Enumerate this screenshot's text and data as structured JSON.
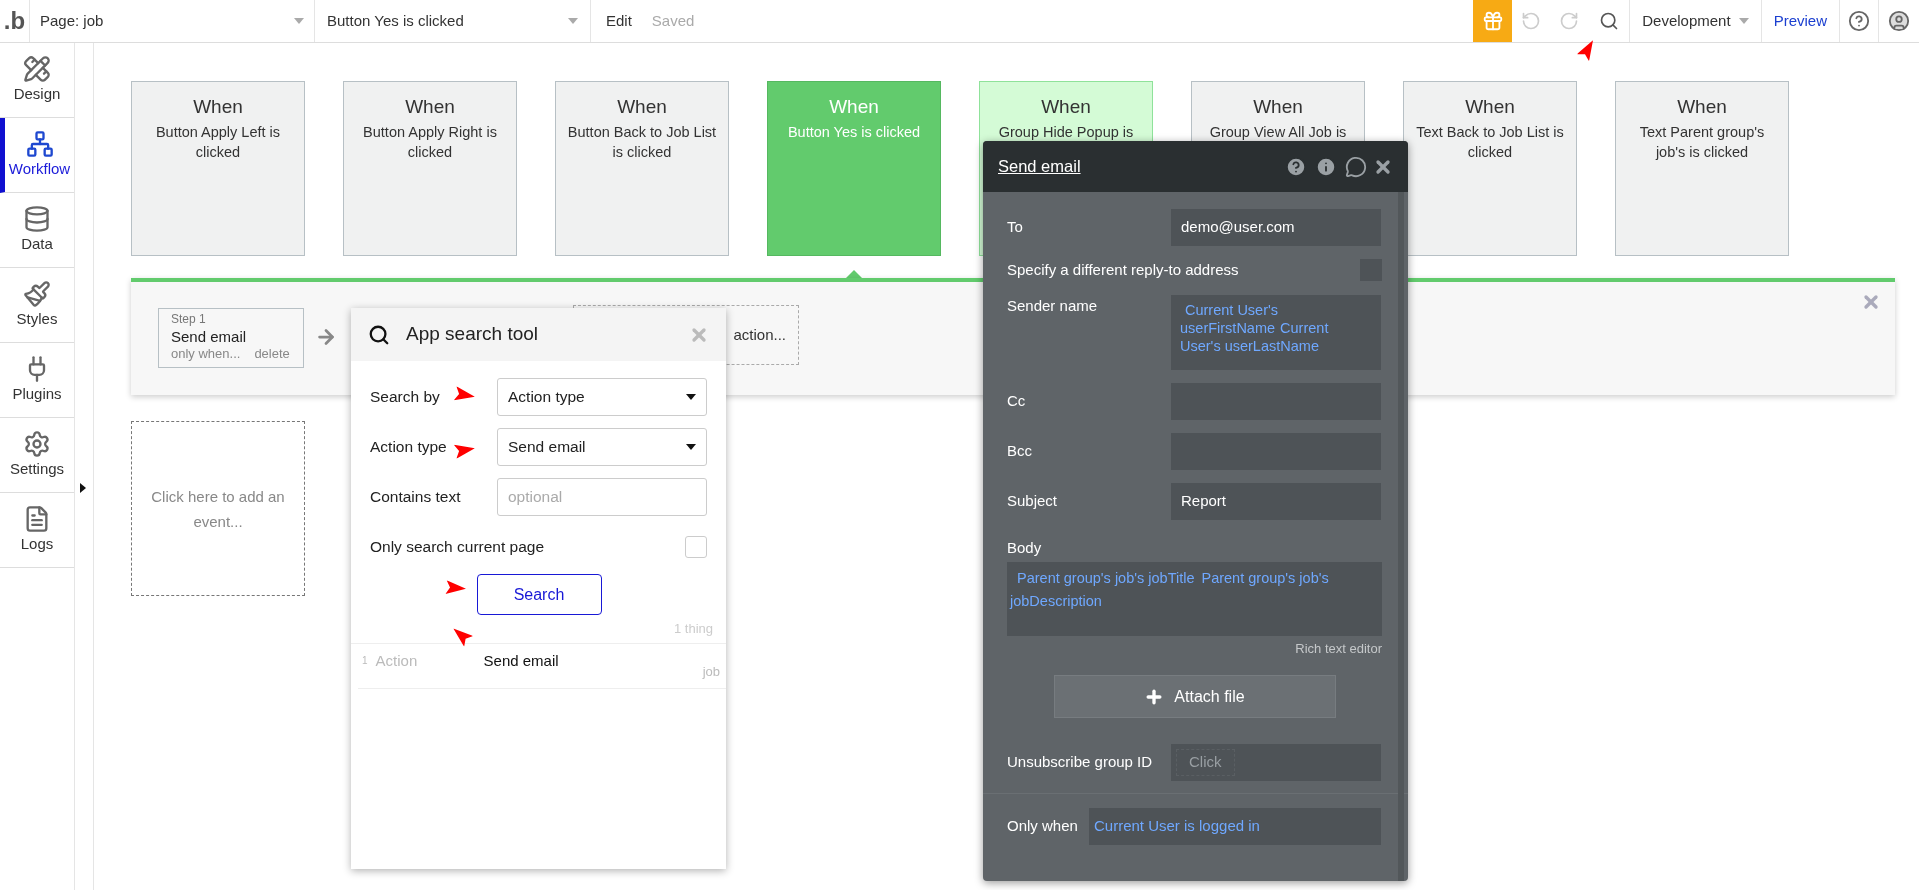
{
  "top_bar": {
    "logo": ".b",
    "page_dropdown": "Page: job",
    "event_dropdown": "Button Yes is clicked",
    "edit": "Edit",
    "save_status": "Saved",
    "environment": "Development",
    "preview": "Preview"
  },
  "sidebar": {
    "items": [
      {
        "label": "Design",
        "kind": "design",
        "selected": false
      },
      {
        "label": "Workflow",
        "kind": "workflow",
        "selected": true
      },
      {
        "label": "Data",
        "kind": "data",
        "selected": false
      },
      {
        "label": "Styles",
        "kind": "styles",
        "selected": false
      },
      {
        "label": "Plugins",
        "kind": "plugins",
        "selected": false
      },
      {
        "label": "Settings",
        "kind": "settings",
        "selected": false
      },
      {
        "label": "Logs",
        "kind": "logs",
        "selected": false
      }
    ]
  },
  "events": [
    {
      "title": "When",
      "description": "Button Apply Left is clicked",
      "selected": false,
      "highlighted": false
    },
    {
      "title": "When",
      "description": "Button Apply Right is clicked",
      "selected": false,
      "highlighted": false
    },
    {
      "title": "When",
      "description": "Button Back to Job List is clicked",
      "selected": false,
      "highlighted": false
    },
    {
      "title": "When",
      "description": "Button Yes is clicked",
      "selected": true,
      "highlighted": false
    },
    {
      "title": "When",
      "description": "Group Hide Popup is",
      "selected": false,
      "highlighted": true
    },
    {
      "title": "When",
      "description": "Group View All Job is",
      "selected": false,
      "highlighted": false
    },
    {
      "title": "When",
      "description": "Text Back to Job List is clicked",
      "selected": false,
      "highlighted": false
    },
    {
      "title": "When",
      "description": "Text Parent group's job's is clicked",
      "selected": false,
      "highlighted": false
    }
  ],
  "workflow": {
    "steps": [
      {
        "step": "Step 1",
        "action": "Send email",
        "only_when": "only when...",
        "delete": "delete"
      }
    ],
    "add_action": "action..."
  },
  "add_event": "Click here to add an event...",
  "search_tool": {
    "title": "App search tool",
    "search_by": {
      "label": "Search by",
      "value": "Action type"
    },
    "action_type": {
      "label": "Action type",
      "value": "Send email"
    },
    "contains_text": {
      "label": "Contains text",
      "placeholder": "optional"
    },
    "only_current_page": {
      "label": "Only search current page",
      "checked": false
    },
    "search_button": "Search",
    "count": "1 thing",
    "results": [
      {
        "index": "1",
        "type": "Action",
        "name": "Send email",
        "page": "job"
      }
    ]
  },
  "action_editor": {
    "title": "Send email",
    "fields": [
      {
        "kind": "text",
        "label": "To",
        "value": "demo@user.com"
      },
      {
        "kind": "checkbox",
        "label": "Specify a different reply-to address",
        "checked": false
      },
      {
        "kind": "dynamic",
        "label": "Sender name",
        "tokens": [
          "Current User's userFirstName",
          "Current User's userLastName"
        ]
      },
      {
        "kind": "text",
        "label": "Cc"
      },
      {
        "kind": "text",
        "label": "Bcc"
      },
      {
        "kind": "text",
        "label": "Subject",
        "value": "Report"
      }
    ],
    "body": {
      "label": "Body",
      "tokens": [
        "Parent group's job's jobTitle",
        "Parent group's job's jobDescription"
      ],
      "hint": "Rich text editor"
    },
    "attach_button": "Attach file",
    "unsubscribe": {
      "label": "Unsubscribe group ID",
      "placeholder": "Click"
    },
    "only_when": {
      "label": "Only when",
      "value": "Current User is logged in"
    }
  }
}
